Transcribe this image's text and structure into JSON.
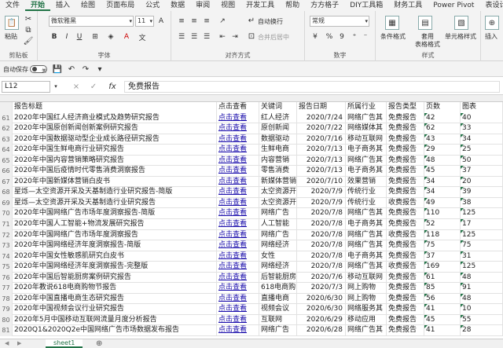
{
  "ribbon_tabs": [
    "文件",
    "开始",
    "插入",
    "绘图",
    "页面布局",
    "公式",
    "数据",
    "审阅",
    "视图",
    "开发工具",
    "帮助",
    "方方格子",
    "DIY工具箱",
    "财务工具",
    "Power Pivot",
    "表设计"
  ],
  "active_tab_index": 1,
  "ribbon": {
    "clipboard": {
      "paste": "粘贴",
      "label": "剪贴板"
    },
    "font": {
      "name": "微软雅黑",
      "size": "11",
      "label": "字体",
      "bold": "B",
      "italic": "I",
      "underline": "U"
    },
    "alignment": {
      "wrap": "自动换行",
      "merge": "合并后居中",
      "label": "对齐方式"
    },
    "number": {
      "format": "常规",
      "label": "数字",
      "percent": "%",
      "comma": "9"
    },
    "styles": {
      "conditional": "条件格式",
      "table_fmt_1": "套用",
      "table_fmt_2": "表格格式",
      "cell_styles": "单元格样式",
      "label": "样式"
    },
    "cells": {
      "insert": "插入"
    }
  },
  "autosave": {
    "label": "自动保存",
    "state": "关"
  },
  "formula_bar": {
    "cell_ref": "L12",
    "cancel": "×",
    "confirm": "✓",
    "fx": "fx",
    "value": "免费报告"
  },
  "table": {
    "headers": {
      "title": "报告标题",
      "link": "点击查看",
      "keyword": "关键词",
      "date": "报告日期",
      "industry": "所属行业",
      "type": "报告类型",
      "pages": "页数",
      "charts": "图表"
    },
    "rows": [
      {
        "n": "61",
        "title": "2020年中国红人经济商业模式及趋势研究报告",
        "link": "点击查看",
        "kw": "红人经济",
        "date": "2020/7/24",
        "ind": "网络广告其",
        "type": "免费报告",
        "pages": "42",
        "charts": "40"
      },
      {
        "n": "62",
        "title": "2020年中国原创新闻创新案例研究报告",
        "link": "点击查看",
        "kw": "原创新闻",
        "date": "2020/7/22",
        "ind": "网络媒体其",
        "type": "免费报告",
        "pages": "62",
        "charts": "33"
      },
      {
        "n": "63",
        "title": "2020年中国数据驱动型企业成长路径研究报告",
        "link": "点击查看",
        "kw": "数据驱动",
        "date": "2020/7/16",
        "ind": "移动互联网",
        "type": "免费报告",
        "pages": "43",
        "charts": "34"
      },
      {
        "n": "64",
        "title": "2020年中国生鲜电商行业研究报告",
        "link": "点击查看",
        "kw": "生鲜电商",
        "date": "2020/7/13",
        "ind": "电子商务其",
        "type": "免费报告",
        "pages": "29",
        "charts": "25"
      },
      {
        "n": "65",
        "title": "2020年中国内容营销策略研究报告",
        "link": "点击查看",
        "kw": "内容营销",
        "date": "2020/7/13",
        "ind": "网络广告其",
        "type": "免费报告",
        "pages": "48",
        "charts": "50"
      },
      {
        "n": "66",
        "title": "2020年中国后疫情时代零售消费洞察报告",
        "link": "点击查看",
        "kw": "零售消费",
        "date": "2020/7/13",
        "ind": "电子商务其",
        "type": "免费报告",
        "pages": "45",
        "charts": "37"
      },
      {
        "n": "67",
        "title": "2020年中国新媒体营销白皮书",
        "link": "点击查看",
        "kw": "新媒体营销",
        "date": "2020/7/10",
        "ind": "效果营销",
        "type": "免费报告",
        "pages": "34",
        "charts": "20"
      },
      {
        "n": "68",
        "title": "星烁—太空资源开采及天基制造行业研究报告-简版",
        "link": "点击查看",
        "kw": "太空资源开",
        "date": "2020/7/9",
        "ind": "传统行业",
        "type": "免费报告",
        "pages": "34",
        "charts": "39"
      },
      {
        "n": "69",
        "title": "星烁—太空资源开采及天基制造行业研究报告",
        "link": "点击查看",
        "kw": "太空资源开",
        "date": "2020/7/9",
        "ind": "传统行业",
        "type": "收费报告",
        "pages": "49",
        "charts": "38"
      },
      {
        "n": "70",
        "title": "2020年中国网络广告市场年度洞察报告-简版",
        "link": "点击查看",
        "kw": "网络广告",
        "date": "2020/7/8",
        "ind": "网络广告其",
        "type": "免费报告",
        "pages": "110",
        "charts": "125"
      },
      {
        "n": "71",
        "title": "2020年中国人工智能+物流发展研究报告",
        "link": "点击查看",
        "kw": "人工智能",
        "date": "2020/7/8",
        "ind": "电子商务其",
        "type": "免费报告",
        "pages": "52",
        "charts": "17"
      },
      {
        "n": "72",
        "title": "2020年中国网络广告市场年度洞察报告",
        "link": "点击查看",
        "kw": "网络广告",
        "date": "2020/7/8",
        "ind": "网络广告其",
        "type": "收费报告",
        "pages": "118",
        "charts": "125"
      },
      {
        "n": "73",
        "title": "2020年中国网络经济年度洞察报告-简版",
        "link": "点击查看",
        "kw": "网络经济",
        "date": "2020/7/8",
        "ind": "网络广告其",
        "type": "免费报告",
        "pages": "75",
        "charts": "75"
      },
      {
        "n": "74",
        "title": "2020年中国女性敏感肌研究白皮书",
        "link": "点击查看",
        "kw": "女性",
        "date": "2020/7/8",
        "ind": "电子商务其",
        "type": "免费报告",
        "pages": "37",
        "charts": "31"
      },
      {
        "n": "75",
        "title": "2020年中国网络经济年度洞察报告-完整版",
        "link": "点击查看",
        "kw": "网络经济",
        "date": "2020/7/8",
        "ind": "网络广告其",
        "type": "收费报告",
        "pages": "169",
        "charts": "125"
      },
      {
        "n": "76",
        "title": "2020年中国后智能厨房案例研究报告",
        "link": "点击查看",
        "kw": "后智能厨房",
        "date": "2020/7/6",
        "ind": "移动互联网",
        "type": "免费报告",
        "pages": "61",
        "charts": "48"
      },
      {
        "n": "77",
        "title": "2020年教说618电商购物节报告",
        "link": "点击查看",
        "kw": "618电商购",
        "date": "2020/7/3",
        "ind": "网上购物",
        "type": "免费报告",
        "pages": "85",
        "charts": "91"
      },
      {
        "n": "78",
        "title": "2020年中国直播电商生态研究报告",
        "link": "点击查看",
        "kw": "直播电商",
        "date": "2020/6/30",
        "ind": "网上购物",
        "type": "免费报告",
        "pages": "56",
        "charts": "48"
      },
      {
        "n": "79",
        "title": "2020年中国视频会议行业研究报告",
        "link": "点击查看",
        "kw": "视频会议",
        "date": "2020/6/30",
        "ind": "网络服务其",
        "type": "免费报告",
        "pages": "41",
        "charts": "10"
      },
      {
        "n": "80",
        "title": "2020年5月中国移动互联网流量月度分析报告",
        "link": "点击查看",
        "kw": "互联网",
        "date": "2020/6/29",
        "ind": "移动应用",
        "type": "免费报告",
        "pages": "45",
        "charts": "55"
      },
      {
        "n": "81",
        "title": "2020Q1&2020Q2e中国网络广告市场数据发布报告",
        "link": "点击查看",
        "kw": "网络广告",
        "date": "2020/6/28",
        "ind": "网络广告其",
        "type": "免费报告",
        "pages": "41",
        "charts": "28"
      }
    ]
  },
  "sheets": [
    "sheet1"
  ],
  "colors": {
    "accent": "#217346",
    "link": "#1a0dab"
  }
}
